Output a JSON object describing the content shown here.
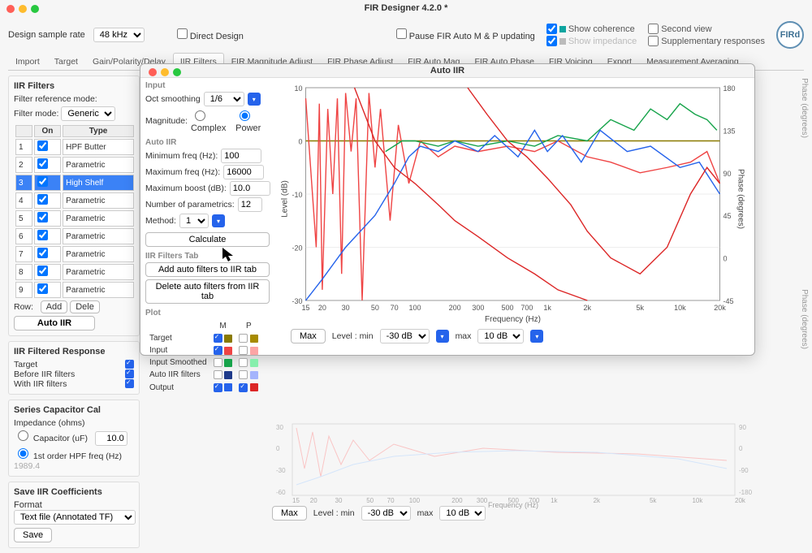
{
  "window_title": "FIR Designer 4.2.0 *",
  "logo_text": "FIRd",
  "design_rate": {
    "label": "Design sample rate",
    "value": "48 kHz"
  },
  "direct_design": "Direct Design",
  "pause_label": "Pause FIR Auto M & P updating",
  "check_cols": [
    [
      {
        "label": "Show coherence",
        "checked": true,
        "color": "#0ea5a0"
      },
      {
        "label": "Show impedance",
        "checked": true,
        "color": "#bbb",
        "muted": true
      }
    ],
    [
      {
        "label": "Second view",
        "checked": false
      },
      {
        "label": "Supplementary responses",
        "checked": false
      }
    ]
  ],
  "tabs": [
    "Import",
    "Target",
    "Gain/Polarity/Delay",
    "IIR Filters",
    "FIR Magnitude Adjust",
    "FIR Phase Adjust",
    "FIR Auto Mag",
    "FIR Auto Phase",
    "FIR Voicing",
    "Export",
    "Measurement Averaging"
  ],
  "active_tab": "IIR Filters",
  "left": {
    "title": "IIR Filters",
    "filter_ref": "Filter reference mode:",
    "filter_mode_label": "Filter mode:",
    "filter_mode_value": "Generic",
    "table": {
      "headers": [
        "",
        "On",
        "Type"
      ],
      "rows": [
        {
          "n": "1",
          "on": true,
          "type": "HPF Butter"
        },
        {
          "n": "2",
          "on": true,
          "type": "Parametric"
        },
        {
          "n": "3",
          "on": true,
          "type": "High Shelf",
          "sel": true
        },
        {
          "n": "4",
          "on": true,
          "type": "Parametric"
        },
        {
          "n": "5",
          "on": true,
          "type": "Parametric"
        },
        {
          "n": "6",
          "on": true,
          "type": "Parametric"
        },
        {
          "n": "7",
          "on": true,
          "type": "Parametric"
        },
        {
          "n": "8",
          "on": true,
          "type": "Parametric"
        },
        {
          "n": "9",
          "on": true,
          "type": "Parametric"
        }
      ]
    },
    "row_label": "Row:",
    "add": "Add",
    "delete": "Dele",
    "auto_iir_btn": "Auto IIR",
    "filtered_title": "IIR Filtered Response",
    "filtered_rows": [
      {
        "label": "Target",
        "checked": true
      },
      {
        "label": "Before IIR filters",
        "checked": true
      },
      {
        "label": "With IIR filters",
        "checked": true
      }
    ],
    "series_title": "Series Capacitor Cal",
    "impedance_label": "Impedance (ohms)",
    "cap_label": "Capacitor (uF)",
    "cap_value": "10.0",
    "hpf_label": "1st order HPF freq (Hz)",
    "hpf_value": "1989.4",
    "save_title": "Save IIR Coefficients",
    "format_label": "Format",
    "format_value": "Text file (Annotated TF)",
    "save_btn": "Save"
  },
  "dialog": {
    "title": "Auto IIR",
    "input_title": "Input",
    "oct_label": "Oct smoothing",
    "oct_value": "1/6",
    "mag_label": "Magnitude:",
    "mag_opts": [
      "Complex",
      "Power"
    ],
    "mag_selected": "Power",
    "auto_title": "Auto IIR",
    "minf": {
      "label": "Minimum freq (Hz):",
      "value": "100"
    },
    "maxf": {
      "label": "Maximum freq (Hz):",
      "value": "16000"
    },
    "maxb": {
      "label": "Maximum boost (dB):",
      "value": "10.0"
    },
    "nparam": {
      "label": "Number of parametrics:",
      "value": "12"
    },
    "method": {
      "label": "Method:",
      "value": "1"
    },
    "calc": "Calculate",
    "tab_title": "IIR Filters Tab",
    "add_auto": "Add auto filters to IIR tab",
    "del_auto": "Delete auto filters from IIR tab",
    "plot_title": "Plot",
    "plot_headers": [
      "",
      "M",
      "P"
    ],
    "plot_rows": [
      {
        "label": "Target",
        "m": true,
        "mcol": "#8a7a00",
        "p": false,
        "pcol": "#a78b00"
      },
      {
        "label": "Input",
        "m": true,
        "mcol": "#ef4444",
        "p": false,
        "pcol": "#fca5a5"
      },
      {
        "label": "Input Smoothed",
        "m": false,
        "mcol": "#16a34a",
        "p": false,
        "pcol": "#86efac"
      },
      {
        "label": "Auto IIR filters",
        "m": false,
        "mcol": "#1e3a8a",
        "p": false,
        "pcol": "#a5b4fc"
      },
      {
        "label": "Output",
        "m": true,
        "mcol": "#2563eb",
        "p": true,
        "pcol": "#dc2626"
      }
    ],
    "axis": {
      "ylabel": "Level (dB)",
      "y2label": "Phase (degrees)",
      "xlabel": "Frequency (Hz)",
      "yticks": [
        "10",
        "0",
        "-10",
        "-20",
        "-30"
      ],
      "y2ticks": [
        "180",
        "135",
        "90",
        "45",
        "0",
        "-45"
      ],
      "xticks": [
        "15",
        "20",
        "30",
        "50",
        "70",
        "100",
        "200",
        "300",
        "500",
        "700",
        "1k",
        "2k",
        "5k",
        "10k",
        "20k"
      ]
    },
    "below": {
      "max": "Max",
      "level_label": "Level : min",
      "min_value": "-30 dB",
      "max_label": "max",
      "max_value": "10 dB"
    }
  },
  "back_axis": {
    "yticks": [
      "30",
      "0",
      "-30",
      "-60"
    ],
    "y2ticks": [
      "90",
      "0",
      "-90",
      "-180"
    ],
    "xticks": [
      "15",
      "20",
      "30",
      "50",
      "70",
      "100",
      "200",
      "300",
      "500",
      "700",
      "1k",
      "2k",
      "5k",
      "10k",
      "20k"
    ],
    "xlabel": "Frequency (Hz)",
    "y2label": "Phase (degrees)"
  },
  "chart_data": {
    "type": "line",
    "title": "Auto IIR",
    "xlabel": "Frequency (Hz)",
    "ylabel": "Level (dB)",
    "y2label": "Phase (degrees)",
    "xscale": "log",
    "xlim": [
      15,
      20000
    ],
    "ylim": [
      -30,
      10
    ],
    "y2lim": [
      -45,
      180
    ],
    "series": [
      {
        "name": "Target",
        "axis": "y",
        "color": "#8a7a00",
        "values": [
          [
            15,
            0
          ],
          [
            20000,
            0
          ]
        ]
      },
      {
        "name": "Input",
        "axis": "y",
        "color": "#ef4444",
        "values": [
          [
            15,
            8
          ],
          [
            18,
            -20
          ],
          [
            19,
            7
          ],
          [
            20,
            -28
          ],
          [
            22,
            6
          ],
          [
            24,
            -10
          ],
          [
            26,
            8
          ],
          [
            28,
            -25
          ],
          [
            30,
            9
          ],
          [
            33,
            -2
          ],
          [
            36,
            8
          ],
          [
            40,
            -30
          ],
          [
            45,
            9
          ],
          [
            50,
            -5
          ],
          [
            55,
            6
          ],
          [
            65,
            -15
          ],
          [
            75,
            3
          ],
          [
            90,
            -8
          ],
          [
            110,
            0
          ],
          [
            150,
            -3
          ],
          [
            200,
            -1
          ],
          [
            300,
            -2
          ],
          [
            500,
            -1
          ],
          [
            800,
            -2
          ],
          [
            1200,
            0
          ],
          [
            2000,
            -3
          ],
          [
            3000,
            -4
          ],
          [
            5000,
            -6
          ],
          [
            8000,
            -5
          ],
          [
            12000,
            -4
          ],
          [
            16000,
            -2
          ],
          [
            20000,
            -8
          ]
        ]
      },
      {
        "name": "Input Smoothed Mag",
        "axis": "y",
        "color": "#16a34a",
        "values": [
          [
            60,
            -2
          ],
          [
            80,
            0
          ],
          [
            100,
            0
          ],
          [
            150,
            -1
          ],
          [
            200,
            0
          ],
          [
            300,
            -1
          ],
          [
            500,
            0
          ],
          [
            800,
            -1
          ],
          [
            1200,
            1
          ],
          [
            2000,
            0
          ],
          [
            3000,
            4
          ],
          [
            4500,
            2
          ],
          [
            6000,
            6
          ],
          [
            8000,
            4
          ],
          [
            10000,
            7
          ],
          [
            13000,
            5
          ],
          [
            16000,
            4
          ],
          [
            19000,
            2
          ]
        ]
      },
      {
        "name": "Output Mag",
        "axis": "y",
        "color": "#2563eb",
        "values": [
          [
            15,
            -30
          ],
          [
            20,
            -26
          ],
          [
            30,
            -20
          ],
          [
            50,
            -14
          ],
          [
            70,
            -8
          ],
          [
            90,
            -3
          ],
          [
            110,
            -1
          ],
          [
            150,
            -2
          ],
          [
            200,
            0
          ],
          [
            300,
            -2
          ],
          [
            400,
            1
          ],
          [
            600,
            -3
          ],
          [
            800,
            2
          ],
          [
            1000,
            -2
          ],
          [
            1300,
            1
          ],
          [
            1800,
            -4
          ],
          [
            2500,
            2
          ],
          [
            4000,
            -2
          ],
          [
            6000,
            -1
          ],
          [
            10000,
            -5
          ],
          [
            14000,
            -4
          ],
          [
            20000,
            -10
          ]
        ]
      },
      {
        "name": "Output Phase 1",
        "axis": "y",
        "color": "#dc2626",
        "values": [
          [
            35,
            10
          ],
          [
            50,
            0
          ],
          [
            70,
            -5
          ],
          [
            100,
            -8
          ],
          [
            150,
            -12
          ],
          [
            200,
            -15
          ],
          [
            300,
            -18
          ],
          [
            500,
            -22
          ],
          [
            800,
            -25
          ],
          [
            1200,
            -28
          ],
          [
            2000,
            -30
          ]
        ]
      },
      {
        "name": "Output Phase 2",
        "axis": "y",
        "color": "#dc2626",
        "values": [
          [
            250,
            10
          ],
          [
            350,
            5
          ],
          [
            500,
            0
          ],
          [
            700,
            -3
          ],
          [
            1000,
            -7
          ],
          [
            1500,
            -12
          ],
          [
            2000,
            -17
          ],
          [
            3000,
            -22
          ],
          [
            5000,
            -25
          ],
          [
            8000,
            -20
          ],
          [
            12000,
            -10
          ],
          [
            16000,
            -5
          ],
          [
            20000,
            -8
          ]
        ]
      }
    ]
  }
}
